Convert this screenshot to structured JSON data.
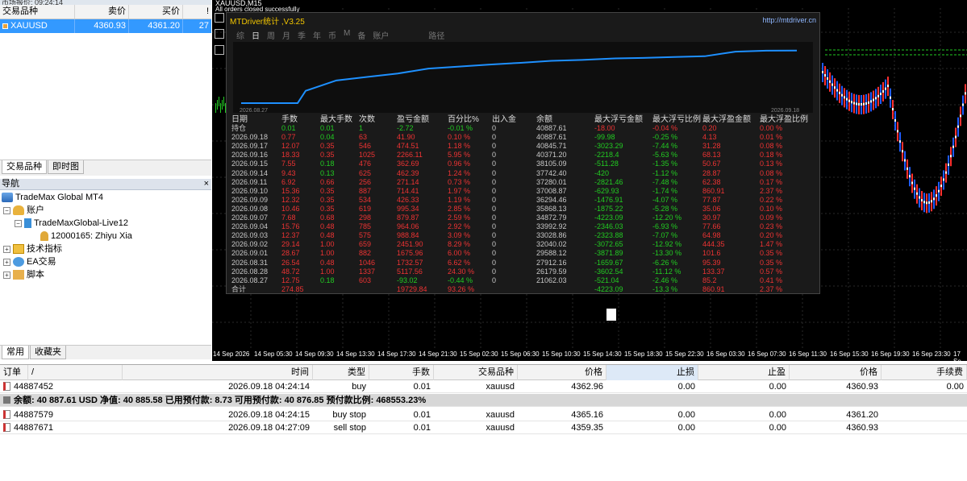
{
  "market_watch": {
    "title": "市场报价: 09:24:14",
    "columns": [
      "交易品种",
      "卖价",
      "买价",
      "!"
    ],
    "row": {
      "symbol": "XAUUSD",
      "bid": "4360.93",
      "ask": "4361.20",
      "spread": "27"
    },
    "tabs": [
      "交易品种",
      "即时图"
    ]
  },
  "navigator": {
    "title": "导航",
    "close": "×",
    "items": [
      {
        "label": "TradeMax Global MT4",
        "level": 0
      },
      {
        "label": "账户",
        "level": 1
      },
      {
        "label": "TradeMaxGlobal-Live12",
        "level": 2
      },
      {
        "label": "12000165: Zhiyu Xia",
        "level": 3
      },
      {
        "label": "技术指标",
        "level": 1
      },
      {
        "label": "EA交易",
        "level": 1
      },
      {
        "label": "脚本",
        "level": 1
      }
    ],
    "tabs": [
      "常用",
      "收藏夹"
    ]
  },
  "chart": {
    "title": "XAUUSD,M15",
    "subtitle": "All orders closed successfully",
    "time_labels": [
      "14 Sep 2026",
      "14 Sep 05:30",
      "14 Sep 09:30",
      "14 Sep 13:30",
      "14 Sep 17:30",
      "14 Sep 21:30",
      "15 Sep 02:30",
      "15 Sep 06:30",
      "15 Sep 10:30",
      "15 Sep 14:30",
      "15 Sep 18:30",
      "15 Sep 22:30",
      "16 Sep 03:30",
      "16 Sep 07:30",
      "16 Sep 11:30",
      "16 Sep 15:30",
      "16 Sep 19:30",
      "16 Sep 23:30",
      "17 Se"
    ]
  },
  "panel": {
    "title": "MTDriver统计 ,V3.25",
    "url": "http://mtdriver.cn",
    "tabs": [
      "综",
      "日",
      "周",
      "月",
      "季",
      "年",
      "币",
      "M",
      "备",
      "账户",
      "路径"
    ],
    "active_tab": "日",
    "mini_chart": {
      "start_label": "2026.08.27",
      "end_label": "2026.09.18"
    },
    "headers": [
      "日期",
      "手数",
      "最大手数",
      "次数",
      "盈亏金额",
      "百分比%",
      "出入金",
      "余额",
      "最大浮亏金额",
      "最大浮亏比例",
      "最大浮盈金额",
      "最大浮盈比例"
    ],
    "rows": [
      [
        "持仓",
        "0.01",
        "0.01",
        "1",
        "-2.72",
        "-0.01 %",
        "0",
        "40887.61",
        "-18.00",
        "-0.04 %",
        "0.20",
        "0.00 %"
      ],
      [
        "2026.09.18",
        "0.77",
        "0.04",
        "63",
        "41.90",
        "0.10 %",
        "0",
        "40887.61",
        "-99.98",
        "-0.25 %",
        "4.13",
        "0.01 %"
      ],
      [
        "2026.09.17",
        "12.07",
        "0.35",
        "546",
        "474.51",
        "1.18 %",
        "0",
        "40845.71",
        "-3023.29",
        "-7.44 %",
        "31.28",
        "0.08 %"
      ],
      [
        "2026.09.16",
        "18.33",
        "0.35",
        "1025",
        "2266.11",
        "5.95 %",
        "0",
        "40371.20",
        "-2218.4",
        "-5.63 %",
        "68.13",
        "0.18 %"
      ],
      [
        "2026.09.15",
        "7.55",
        "0.18",
        "476",
        "362.69",
        "0.96 %",
        "0",
        "38105.09",
        "-511.28",
        "-1.35 %",
        "50.67",
        "0.13 %"
      ],
      [
        "2026.09.14",
        "9.43",
        "0.13",
        "625",
        "462.39",
        "1.24 %",
        "0",
        "37742.40",
        "-420",
        "-1.12 %",
        "28.87",
        "0.08 %"
      ],
      [
        "2026.09.11",
        "6.92",
        "0.66",
        "256",
        "271.14",
        "0.73 %",
        "0",
        "37280.01",
        "-2821.46",
        "-7.48 %",
        "62.38",
        "0.17 %"
      ],
      [
        "2026.09.10",
        "15.36",
        "0.35",
        "887",
        "714.41",
        "1.97 %",
        "0",
        "37008.87",
        "-629.93",
        "-1.74 %",
        "860.91",
        "2.37 %"
      ],
      [
        "2026.09.09",
        "12.32",
        "0.35",
        "534",
        "426.33",
        "1.19 %",
        "0",
        "36294.46",
        "-1476.91",
        "-4.07 %",
        "77.87",
        "0.22 %"
      ],
      [
        "2026.09.08",
        "10.46",
        "0.35",
        "619",
        "995.34",
        "2.85 %",
        "0",
        "35868.13",
        "-1875.22",
        "-5.28 %",
        "35.06",
        "0.10 %"
      ],
      [
        "2026.09.07",
        "7.68",
        "0.68",
        "298",
        "879.87",
        "2.59 %",
        "0",
        "34872.79",
        "-4223.09",
        "-12.20 %",
        "30.97",
        "0.09 %"
      ],
      [
        "2026.09.04",
        "15.76",
        "0.48",
        "785",
        "964.06",
        "2.92 %",
        "0",
        "33992.92",
        "-2346.03",
        "-6.93 %",
        "77.66",
        "0.23 %"
      ],
      [
        "2026.09.03",
        "12.37",
        "0.48",
        "575",
        "988.84",
        "3.09 %",
        "0",
        "33028.86",
        "-2323.88",
        "-7.07 %",
        "64.98",
        "0.20 %"
      ],
      [
        "2026.09.02",
        "29.14",
        "1.00",
        "659",
        "2451.90",
        "8.29 %",
        "0",
        "32040.02",
        "-3072.65",
        "-12.92 %",
        "444.35",
        "1.47 %"
      ],
      [
        "2026.09.01",
        "28.67",
        "1.00",
        "882",
        "1675.96",
        "6.00 %",
        "0",
        "29588.12",
        "-3871.89",
        "-13.30 %",
        "101.6",
        "0.35 %"
      ],
      [
        "2026.08.31",
        "26.54",
        "0.48",
        "1046",
        "1732.57",
        "6.62 %",
        "0",
        "27912.16",
        "-1659.67",
        "-6.26 %",
        "95.39",
        "0.35 %"
      ],
      [
        "2026.08.28",
        "48.72",
        "1.00",
        "1337",
        "5117.56",
        "24.30 %",
        "0",
        "26179.59",
        "-3602.54",
        "-11.12 %",
        "133.37",
        "0.57 %"
      ],
      [
        "2026.08.27",
        "12.75",
        "0.18",
        "603",
        "-93.02",
        "-0.44 %",
        "0",
        "21062.03",
        "-521.04",
        "-2.46 %",
        "85.2",
        "0.41 %"
      ],
      [
        "合计",
        "274.85",
        "",
        "",
        "19729.84",
        "93.26 %",
        "",
        "",
        "-4223.09",
        "-13.3 %",
        "860.91",
        "2.37 %"
      ]
    ]
  },
  "terminal": {
    "headers": [
      "订单",
      "/",
      "时间",
      "类型",
      "手数",
      "交易品种",
      "价格",
      "止损",
      "止盈",
      "价格",
      "手续费"
    ],
    "rows": [
      {
        "order": "44887452",
        "time": "2026.09.18 04:24:14",
        "type": "buy",
        "lots": "0.01",
        "symbol": "xauusd",
        "price": "4362.96",
        "sl": "0.00",
        "tp": "0.00",
        "cur": "4360.93",
        "fee": "0.00"
      },
      {
        "order": "44887579",
        "time": "2026.09.18 04:24:15",
        "type": "buy stop",
        "lots": "0.01",
        "symbol": "xauusd",
        "price": "4365.16",
        "sl": "0.00",
        "tp": "0.00",
        "cur": "4361.20",
        "fee": ""
      },
      {
        "order": "44887671",
        "time": "2026.09.18 04:27:09",
        "type": "sell stop",
        "lots": "0.01",
        "symbol": "xauusd",
        "price": "4359.35",
        "sl": "0.00",
        "tp": "0.00",
        "cur": "4360.93",
        "fee": ""
      }
    ],
    "balance_line": "余额: 40 887.61 USD  净值: 40 885.58  已用预付款: 8.73  可用预付款: 40 876.85  预付款比例: 468553.23%"
  }
}
